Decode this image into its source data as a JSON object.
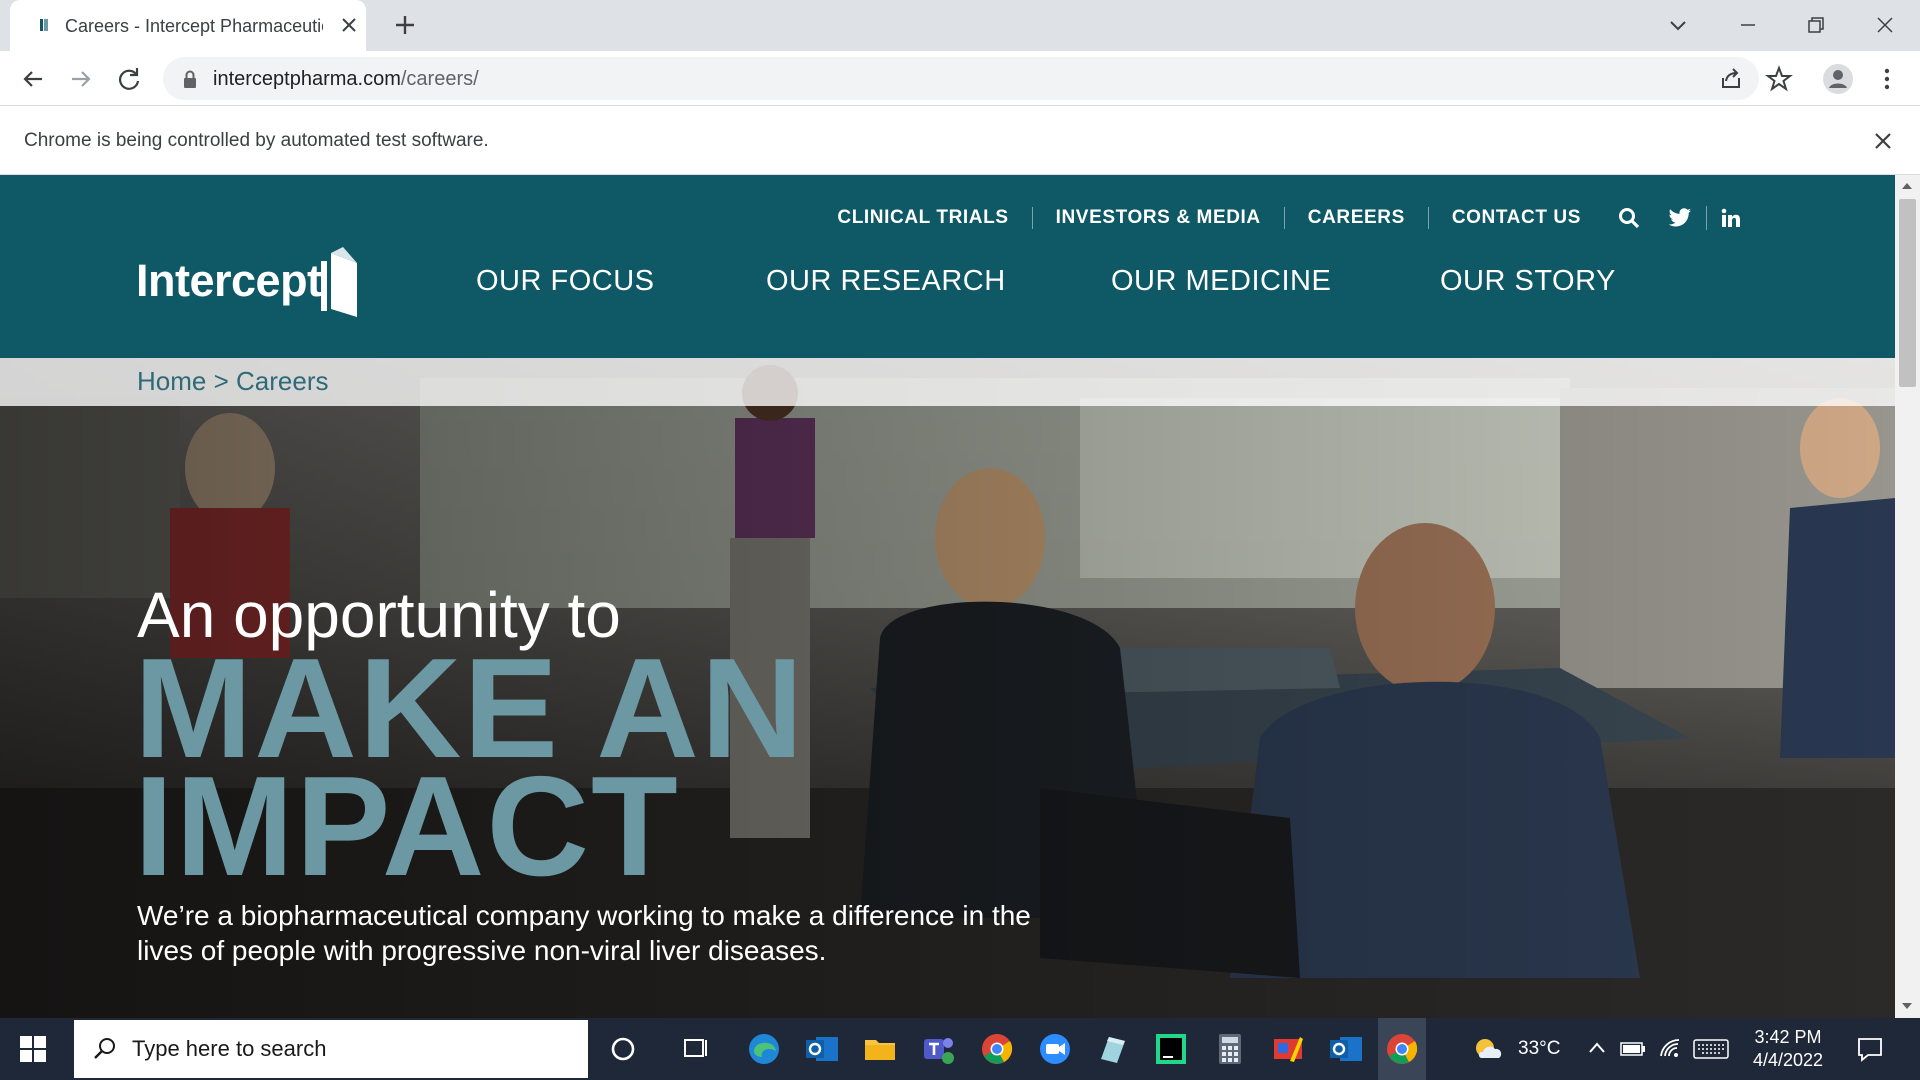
{
  "browser": {
    "tab_title": "Careers - Intercept Pharmaceutic",
    "url_domain": "interceptpharma.com",
    "url_path": "/careers/",
    "infobar_text": "Chrome is being controlled by automated test software."
  },
  "site": {
    "logo_text": "Intercept",
    "utility_nav": [
      "CLINICAL TRIALS",
      "INVESTORS & MEDIA",
      "CAREERS",
      "CONTACT US"
    ],
    "main_nav": [
      "OUR FOCUS",
      "OUR RESEARCH",
      "OUR MEDICINE",
      "OUR STORY"
    ],
    "brand_color": "#0f5866",
    "accent_color": "#6b98a2"
  },
  "breadcrumb": {
    "home": "Home",
    "separator": ">",
    "current": "Careers"
  },
  "hero": {
    "kicker": "An opportunity to",
    "title_line1": "MAKE AN",
    "title_line2": "IMPACT",
    "description_line1": "We’re a biopharmaceutical company working to make a difference in the",
    "description_line2": "lives of people with progressive non-viral liver diseases."
  },
  "taskbar": {
    "search_placeholder": "Type here to search",
    "weather": "33°C",
    "time": "3:42 PM",
    "date": "4/4/2022",
    "apps": [
      "cortana-icon",
      "task-view-icon",
      "edge-icon",
      "outlook-icon",
      "file-explorer-icon",
      "teams-icon",
      "chrome-icon",
      "zoom-icon",
      "notes-icon",
      "pycharm-icon",
      "calculator-icon",
      "paint-icon",
      "outlook-icon",
      "chrome-icon"
    ]
  }
}
